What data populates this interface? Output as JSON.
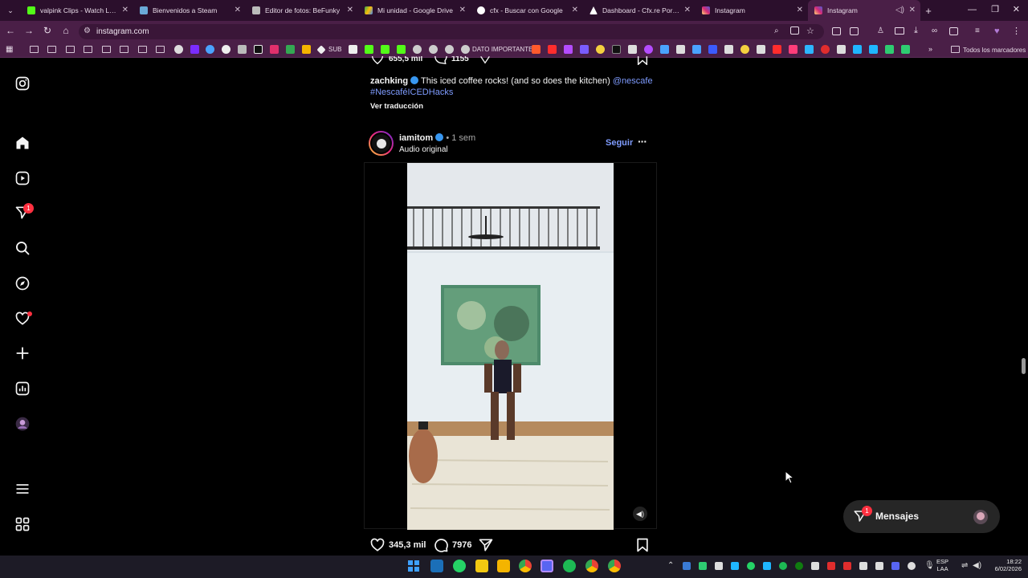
{
  "tabs": [
    {
      "label": "valpink Clips - Watch Live on",
      "color": "#53fc18"
    },
    {
      "label": "Bienvenidos a Steam",
      "color": "#6aa9d8"
    },
    {
      "label": "Editor de fotos: BeFunky",
      "color": "#bbbbbb"
    },
    {
      "label": "Mi unidad - Google Drive",
      "color": "#34a853"
    },
    {
      "label": "cfx - Buscar con Google",
      "color": "#ffffff"
    },
    {
      "label": "Dashboard - Cfx.re Portal",
      "color": "#ffffff"
    },
    {
      "label": "Instagram",
      "color": "#e1306c"
    },
    {
      "label": "Instagram",
      "color": "#e1306c"
    }
  ],
  "browser": {
    "url": "instagram.com",
    "bookmark_sub": "SUB",
    "bookmark_dato": "DATO IMPORTANTE",
    "all_bookmarks": "Todos los marcadores"
  },
  "prev_post": {
    "likes": "655,5 mil",
    "comments": "1155",
    "author": "zachking",
    "caption": "This iced coffee rocks! (and so does the kitchen)",
    "mention": "@nescafe",
    "hashtag": "#NescaféICEDHacks",
    "translate": "Ver traducción"
  },
  "post": {
    "author": "iamitom",
    "time": "1 sem",
    "audio": "Audio original",
    "follow": "Seguir",
    "likes": "345,3 mil",
    "comments": "7976"
  },
  "sidebar": {
    "notification_count": "1"
  },
  "messages": {
    "label": "Mensajes",
    "count": "1"
  },
  "taskbar": {
    "lang": "ESP",
    "layout": "LAA",
    "time": "18:22",
    "date": "6/02/2026"
  },
  "colors": {
    "tab_bg": "#2b0f2c",
    "toolbar_bg": "#4a1f47",
    "ig_bg": "#000000",
    "link_blue": "#7f9cff",
    "badge_red": "#ff3040"
  }
}
